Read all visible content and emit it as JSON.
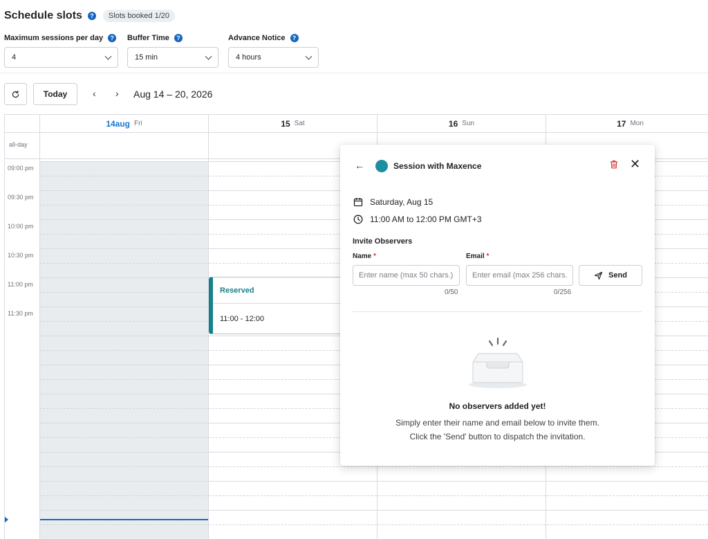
{
  "header": {
    "title": "Schedule slots",
    "slots_badge": "Slots booked 1/20"
  },
  "settings": {
    "max_sessions": {
      "label": "Maximum sessions per day",
      "value": "4"
    },
    "buffer_time": {
      "label": "Buffer Time",
      "value": "15 min"
    },
    "advance_notice": {
      "label": "Advance Notice",
      "value": "4 hours"
    }
  },
  "toolbar": {
    "today_label": "Today",
    "prev": "‹",
    "next": "›",
    "date_range": "Aug 14 – 20, 2026"
  },
  "calendar": {
    "days": [
      {
        "num": "14",
        "month": "aug",
        "name": "Fri",
        "today": true
      },
      {
        "num": "15",
        "name": "Sat"
      },
      {
        "num": "16",
        "name": "Sun"
      },
      {
        "num": "17",
        "name": "Mon"
      }
    ],
    "allday_label": "all-day",
    "time_labels": [
      "09:00 pm",
      "09:30 pm",
      "10:00 pm",
      "10:30 pm",
      "11:00 pm",
      "11:30 pm"
    ],
    "event": {
      "title": "Reserved",
      "time": "11:00 - 12:00"
    }
  },
  "popup": {
    "title": "Session with Maxence",
    "color": "#1b8fa0",
    "date": "Saturday, Aug 15",
    "time": "11:00 AM to 12:00 PM GMT+3",
    "invite_label": "Invite Observers",
    "name_label": "Name",
    "email_label": "Email",
    "required_mark": "*",
    "name_placeholder": "Enter name (max 50 chars.)",
    "email_placeholder": "Enter email (max 256 chars.)",
    "name_counter": "0/50",
    "email_counter": "0/256",
    "send_label": "Send",
    "empty_title": "No observers added yet!",
    "empty_line1": "Simply enter their name and email below to invite them.",
    "empty_line2": "Click the 'Send' button to dispatch the invitation."
  },
  "colors": {
    "accent": "#1565c0",
    "event_accent": "#16818a",
    "danger": "#d32f2f"
  }
}
